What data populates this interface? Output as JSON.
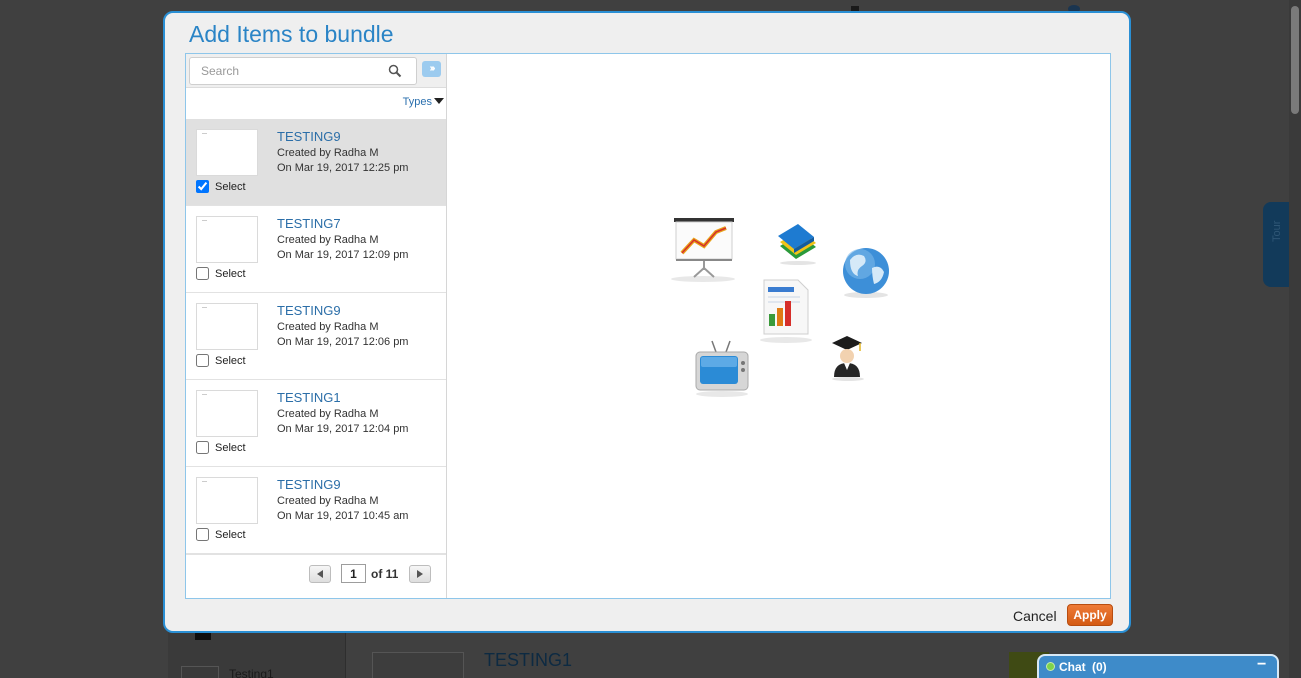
{
  "modal": {
    "title": "Add Items to bundle",
    "search_placeholder": "Search",
    "types_label": "Types",
    "cancel_label": "Cancel",
    "apply_label": "Apply",
    "accent_color": "#2a84c6",
    "apply_color": "#e06a24"
  },
  "items": [
    {
      "title": "TESTING9",
      "created": "Created by Radha M",
      "date": "On Mar 19, 2017 12:25 pm",
      "select_label": "Select",
      "checked": true
    },
    {
      "title": "TESTING7",
      "created": "Created by Radha M",
      "date": "On Mar 19, 2017 12:09 pm",
      "select_label": "Select",
      "checked": false
    },
    {
      "title": "TESTING9",
      "created": "Created by Radha M",
      "date": "On Mar 19, 2017 12:06 pm",
      "select_label": "Select",
      "checked": false
    },
    {
      "title": "TESTING1",
      "created": "Created by Radha M",
      "date": "On Mar 19, 2017 12:04 pm",
      "select_label": "Select",
      "checked": false
    },
    {
      "title": "TESTING9",
      "created": "Created by Radha M",
      "date": "On Mar 19, 2017 10:45 am",
      "select_label": "Select",
      "checked": false
    }
  ],
  "pager": {
    "current_page": "1",
    "of_label": "of 11"
  },
  "background": {
    "title": "TESTING1",
    "left_item": "Testing1",
    "tour_label": "Tour"
  },
  "chat": {
    "label": "Chat",
    "count": "(0)",
    "minimize": "−"
  }
}
